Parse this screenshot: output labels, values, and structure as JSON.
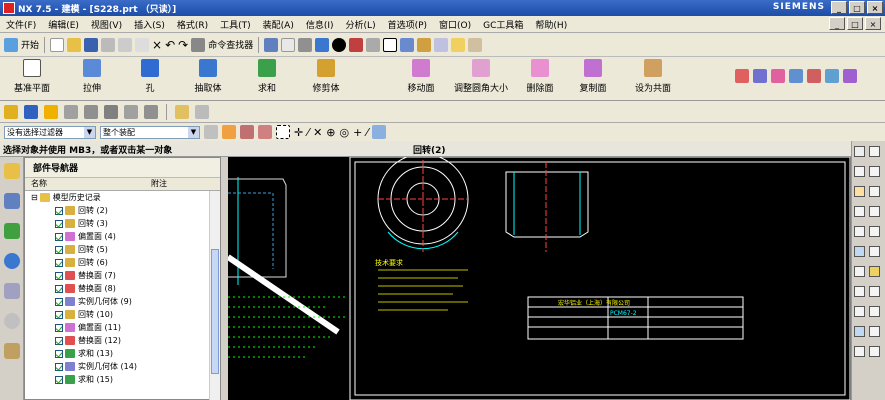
{
  "window": {
    "title": "NX 7.5 - 建模 - [S228.prt （只读）]",
    "brand": "SIEMENS",
    "buttons": [
      "_",
      "□",
      "×"
    ]
  },
  "menu": [
    "文件(F)",
    "编辑(E)",
    "视图(V)",
    "插入(S)",
    "格式(R)",
    "工具(T)",
    "装配(A)",
    "信息(I)",
    "分析(L)",
    "首选项(P)",
    "窗口(O)",
    "GC工具箱",
    "帮助(H)"
  ],
  "toolbar1": {
    "start": "开始",
    "cmd_finder": "命令查找器"
  },
  "toolbar2": [
    {
      "label": "基准平面",
      "color": "#b0c4de"
    },
    {
      "label": "拉伸",
      "color": "#5a8ad8"
    },
    {
      "label": "孔",
      "color": "#2f6bd0"
    },
    {
      "label": "抽取体",
      "color": "#3a78d0"
    },
    {
      "label": "求和",
      "color": "#3aa04a"
    },
    {
      "label": "修剪体",
      "color": "#d4a030"
    },
    {
      "label": "移动面",
      "color": "#d07ad0"
    },
    {
      "label": "调整圆角大小",
      "color": "#e0a0d0"
    },
    {
      "label": "删除面",
      "color": "#e890d0"
    },
    {
      "label": "复制面",
      "color": "#c070d0"
    },
    {
      "label": "设为共面",
      "color": "#d0a060"
    }
  ],
  "filter": {
    "type_filter": "没有选择过滤器",
    "scope": "整个装配"
  },
  "status": {
    "prompt": "选择对象并使用 MB3，或者双击某一对象",
    "dialog": "回转(2)"
  },
  "navigator": {
    "title": "部件导航器",
    "columns": [
      "名称",
      "附注"
    ],
    "root": "模型历史记录",
    "items": [
      {
        "label": "回转 (2)",
        "color": "#d8b040"
      },
      {
        "label": "回转 (3)",
        "color": "#d8b040"
      },
      {
        "label": "偏置面 (4)",
        "color": "#d070d0"
      },
      {
        "label": "回转 (5)",
        "color": "#d8b040"
      },
      {
        "label": "回转 (6)",
        "color": "#d8b040"
      },
      {
        "label": "替换面 (7)",
        "color": "#e05050"
      },
      {
        "label": "替换面 (8)",
        "color": "#e05050"
      },
      {
        "label": "实例几何体 (9)",
        "color": "#8080d0"
      },
      {
        "label": "回转 (10)",
        "color": "#d8b040"
      },
      {
        "label": "偏置面 (11)",
        "color": "#d070d0"
      },
      {
        "label": "替换面 (12)",
        "color": "#e05050"
      },
      {
        "label": "求和 (13)",
        "color": "#3aa04a"
      },
      {
        "label": "实例几何体 (14)",
        "color": "#8080d0"
      },
      {
        "label": "求和 (15)",
        "color": "#3aa04a"
      }
    ]
  },
  "drawing": {
    "note_title": "技术要求",
    "company": "宏华铝业（上海）有限公司",
    "part_no": "PCM67-2"
  }
}
